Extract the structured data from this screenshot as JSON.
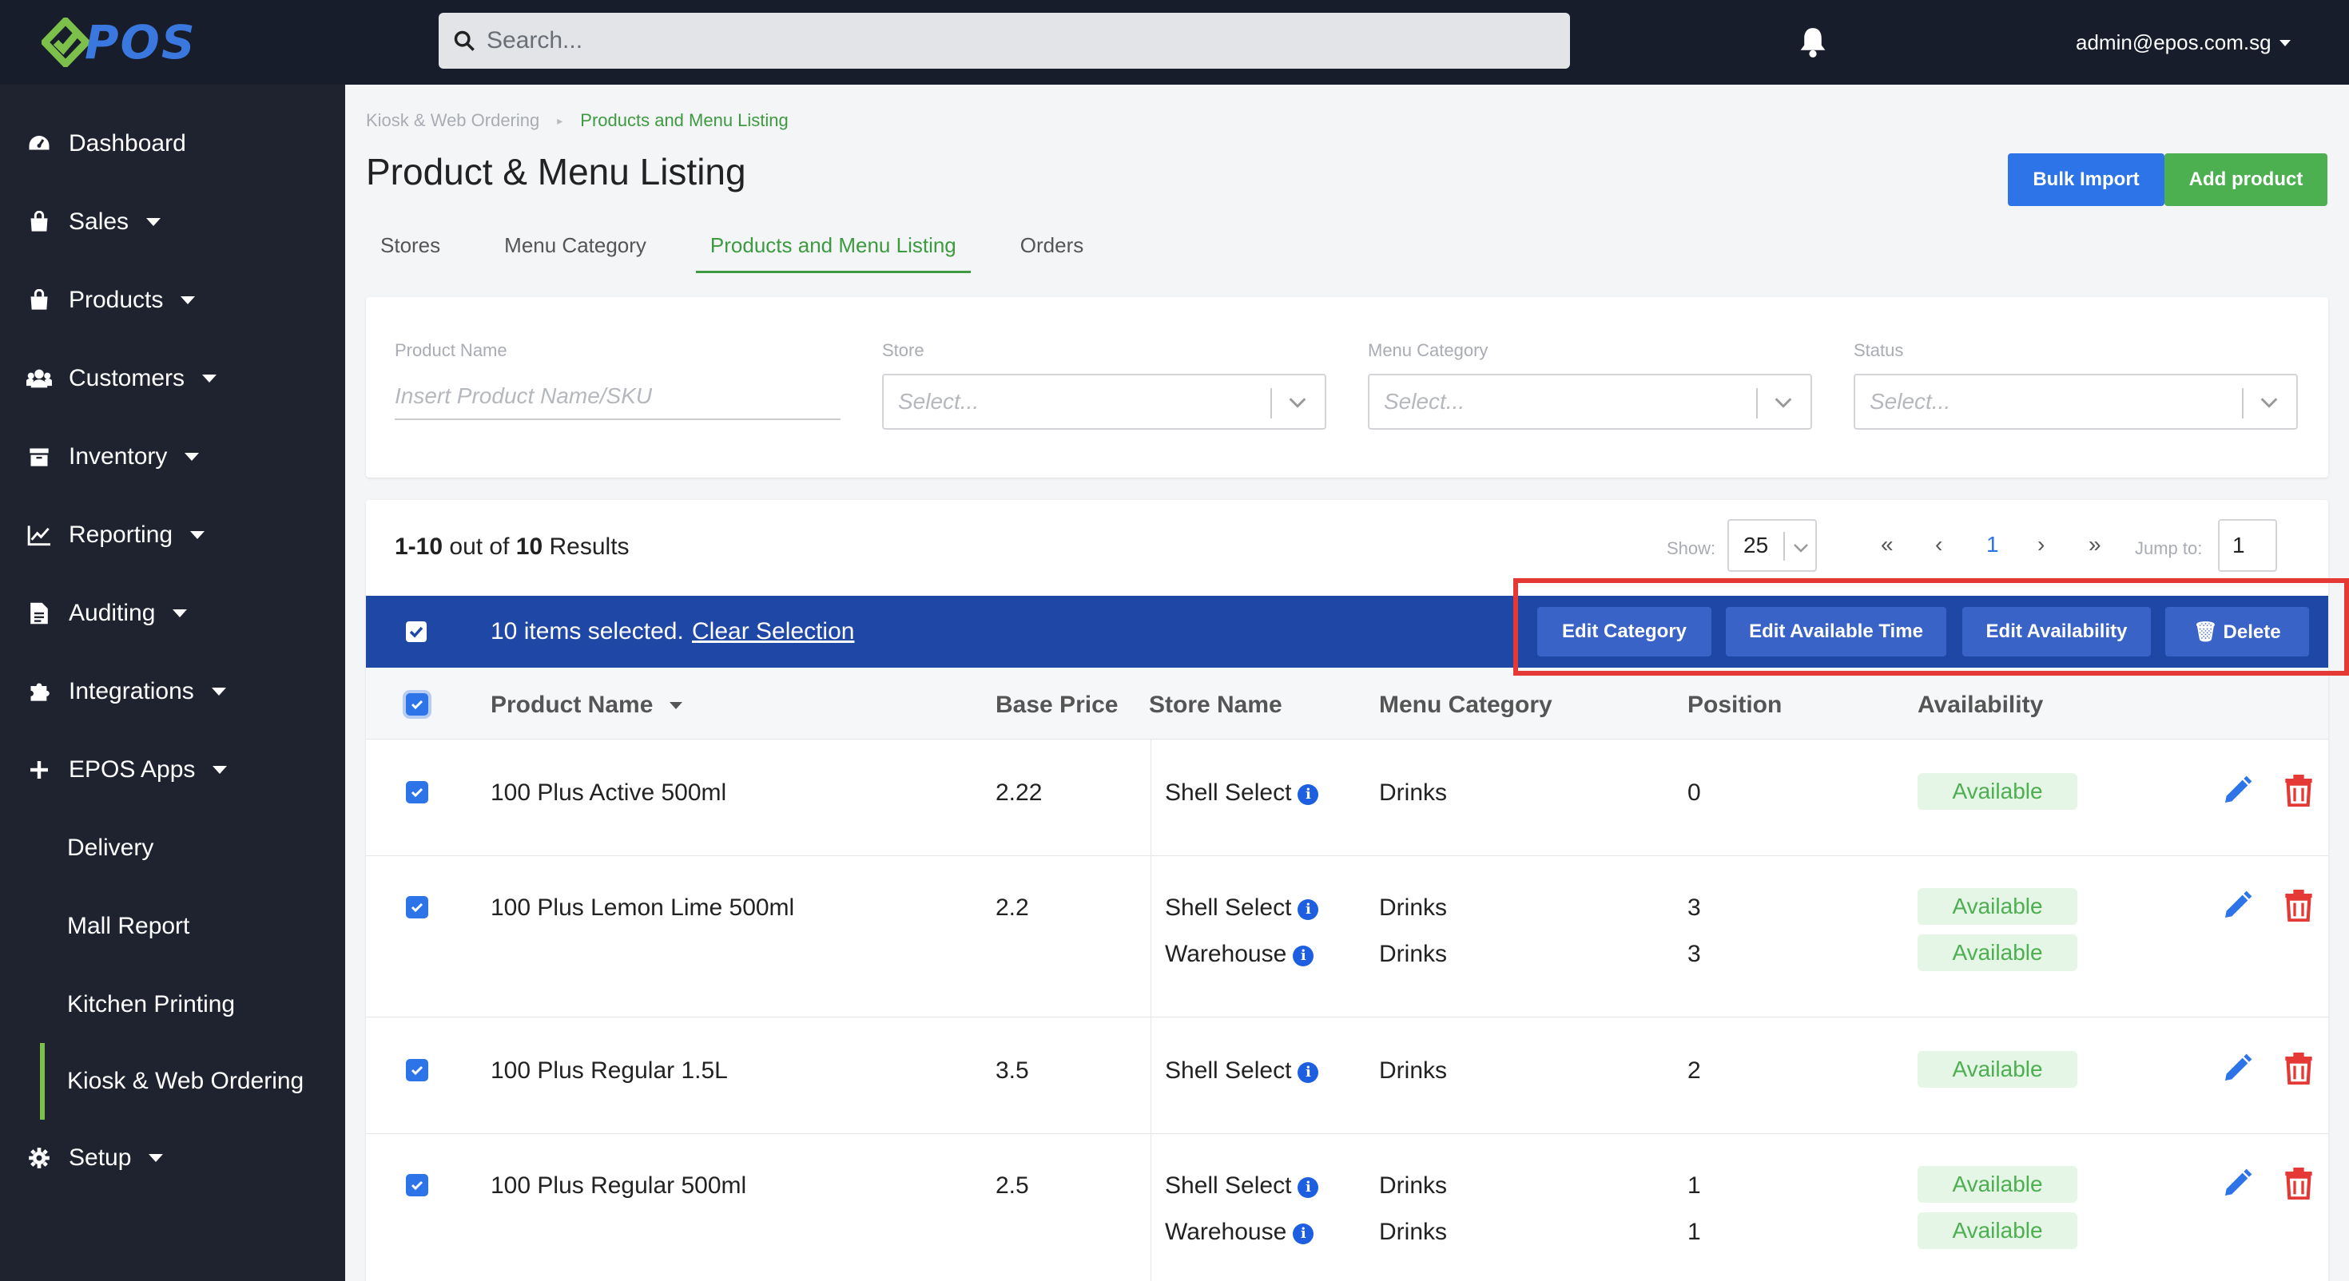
{
  "app": {
    "logo_text": "POS",
    "search_placeholder": "Search...",
    "user_email": "admin@epos.com.sg"
  },
  "sidebar": {
    "items": [
      {
        "label": "Dashboard",
        "icon": "dashboard-icon"
      },
      {
        "label": "Sales",
        "icon": "shopping-bag-icon"
      },
      {
        "label": "Products",
        "icon": "products-bag-icon"
      },
      {
        "label": "Customers",
        "icon": "users-icon"
      },
      {
        "label": "Inventory",
        "icon": "archive-box-icon"
      },
      {
        "label": "Reporting",
        "icon": "line-chart-icon"
      },
      {
        "label": "Auditing",
        "icon": "document-icon"
      },
      {
        "label": "Integrations",
        "icon": "puzzle-icon"
      },
      {
        "label": "EPOS Apps",
        "icon": "plus-icon"
      }
    ],
    "sub_items": [
      "Delivery",
      "Mall Report",
      "Kitchen Printing",
      "Kiosk & Web Ordering"
    ],
    "setup": "Setup"
  },
  "breadcrumb": {
    "parent": "Kiosk & Web Ordering",
    "current": "Products and Menu Listing"
  },
  "page": {
    "title": "Product & Menu Listing",
    "bulk_import": "Bulk Import",
    "add_product": "Add product"
  },
  "tabs": [
    "Stores",
    "Menu Category",
    "Products and Menu Listing",
    "Orders"
  ],
  "filters": {
    "product_name_label": "Product Name",
    "product_name_placeholder": "Insert Product Name/SKU",
    "store_label": "Store",
    "menu_category_label": "Menu Category",
    "status_label": "Status",
    "select_placeholder": "Select..."
  },
  "results": {
    "range": "1-10",
    "mid": " out of ",
    "total": "10",
    "suffix": " Results",
    "show_label": "Show:",
    "show_value": "25",
    "pager_first": "«",
    "pager_prev": "‹",
    "pager_current": "1",
    "pager_next": "›",
    "pager_last": "»",
    "jump_label": "Jump to:",
    "jump_value": "1"
  },
  "selection": {
    "text": "10 items selected.",
    "clear": "Clear Selection",
    "actions": [
      "Edit Category",
      "Edit Available Time",
      "Edit Availability",
      "🗑 Delete"
    ]
  },
  "table": {
    "headers": [
      "Product Name",
      "Base Price",
      "Store Name",
      "Menu Category",
      "Position",
      "Availability"
    ],
    "rows": [
      {
        "name": "100 Plus Active 500ml",
        "price": "2.22",
        "stores": [
          {
            "store": "Shell Select",
            "category": "Drinks",
            "position": "0",
            "availability": "Available"
          }
        ]
      },
      {
        "name": "100 Plus Lemon Lime 500ml",
        "price": "2.2",
        "stores": [
          {
            "store": "Shell Select",
            "category": "Drinks",
            "position": "3",
            "availability": "Available"
          },
          {
            "store": "Warehouse",
            "category": "Drinks",
            "position": "3",
            "availability": "Available"
          }
        ]
      },
      {
        "name": "100 Plus Regular 1.5L",
        "price": "3.5",
        "stores": [
          {
            "store": "Shell Select",
            "category": "Drinks",
            "position": "2",
            "availability": "Available"
          }
        ]
      },
      {
        "name": "100 Plus Regular 500ml",
        "price": "2.5",
        "stores": [
          {
            "store": "Shell Select",
            "category": "Drinks",
            "position": "1",
            "availability": "Available"
          },
          {
            "store": "Warehouse",
            "category": "Drinks",
            "position": "1",
            "availability": "Available"
          }
        ]
      }
    ]
  },
  "colors": {
    "topbar": "#181d2b",
    "sidebar": "#1f2330",
    "primary": "#2d74e8",
    "success": "#4caf50",
    "selection_bar": "#1e47a6",
    "danger": "#e53935"
  }
}
